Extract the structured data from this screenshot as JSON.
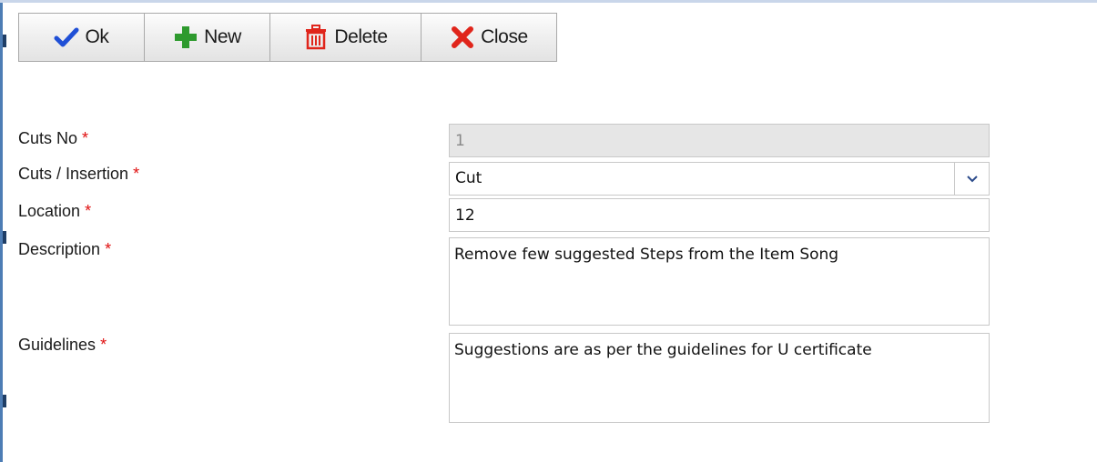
{
  "toolbar": {
    "ok_label": "Ok",
    "new_label": "New",
    "delete_label": "Delete",
    "close_label": "Close"
  },
  "icons": {
    "ok": "checkmark-icon",
    "new": "plus-icon",
    "delete": "trash-icon",
    "close": "close-x-icon"
  },
  "colors": {
    "required_marker": "#e01010",
    "ok_icon": "#1f4fd6",
    "new_icon": "#2e9a2e",
    "delete_icon": "#e0251b",
    "close_icon": "#e0251b",
    "dropdown_chevron": "#2b4a8a"
  },
  "form": {
    "required_marker": "*",
    "cuts_no": {
      "label": "Cuts No",
      "value": "1"
    },
    "cuts_insertion": {
      "label": "Cuts / Insertion",
      "value": "Cut"
    },
    "location": {
      "label": "Location",
      "value": "12"
    },
    "description": {
      "label": "Description",
      "value": "Remove few suggested Steps from the Item Song"
    },
    "guidelines": {
      "label": "Guidelines",
      "value": "Suggestions are as per the guidelines for U certificate"
    }
  }
}
